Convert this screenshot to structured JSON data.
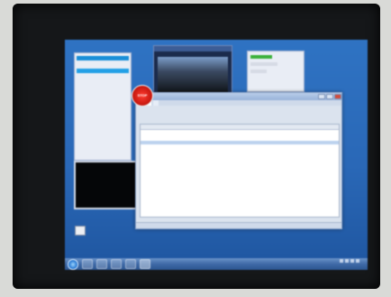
{
  "photo": {
    "left_stats_rows": [
      [
        "",
        ""
      ],
      [
        "",
        ""
      ],
      [
        "",
        ""
      ],
      [
        "",
        ""
      ],
      [
        "",
        ""
      ],
      [
        "",
        ""
      ],
      [
        "",
        ""
      ],
      [
        "",
        ""
      ],
      [
        "",
        ""
      ],
      [
        "",
        ""
      ]
    ],
    "black_box_lines": [
      "",
      ""
    ],
    "video_title": "",
    "stop_label": "STOP",
    "main_window": {
      "tabs": [
        "",
        "",
        ""
      ],
      "info_lines": [
        "",
        ""
      ],
      "columns": [
        "",
        "",
        "",
        "",
        ""
      ],
      "rows": [
        [
          "",
          "",
          "",
          "",
          ""
        ],
        [
          "",
          "",
          "",
          "",
          ""
        ],
        [
          "",
          "",
          "",
          "",
          ""
        ],
        [
          "",
          "",
          "",
          "",
          ""
        ],
        [
          "",
          "",
          "",
          "",
          ""
        ],
        [
          "",
          "",
          "",
          "",
          ""
        ],
        [
          "",
          "",
          "",
          "",
          ""
        ],
        [
          "",
          "",
          "",
          "",
          ""
        ],
        [
          "",
          "",
          "",
          "",
          ""
        ]
      ],
      "selected_row": 3,
      "status_text": ""
    },
    "desktop_icon_label": "",
    "clock": {
      "time": "",
      "date": ""
    },
    "colors": {
      "desktop": "#2a68b7",
      "taskbar": "#3f6aa7",
      "stop_badge": "#e02a20",
      "bezel": "#151719"
    }
  }
}
